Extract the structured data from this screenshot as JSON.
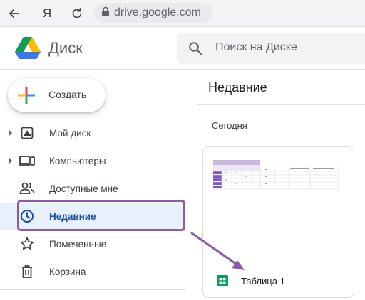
{
  "browser": {
    "url": "drive.google.com",
    "yandex_glyph": "Я"
  },
  "header": {
    "app_title": "Диск",
    "search_placeholder": "Поиск на Диске"
  },
  "sidebar": {
    "create_label": "Создать",
    "items": [
      {
        "label": "Мой диск",
        "icon": "my-drive-icon",
        "expandable": true
      },
      {
        "label": "Компьютеры",
        "icon": "computers-icon",
        "expandable": true
      },
      {
        "label": "Доступные мне",
        "icon": "shared-with-me-icon",
        "expandable": false
      },
      {
        "label": "Недавние",
        "icon": "recent-clock-icon",
        "expandable": false,
        "active": true
      },
      {
        "label": "Помеченные",
        "icon": "star-icon",
        "expandable": false
      },
      {
        "label": "Корзина",
        "icon": "trash-icon",
        "expandable": false
      }
    ]
  },
  "main": {
    "title": "Недавние",
    "section": "Сегодня",
    "files": [
      {
        "name": "Таблица 1",
        "type": "spreadsheet",
        "icon": "google-sheets-icon"
      }
    ]
  },
  "colors": {
    "active_bg": "#e8f0fe",
    "active_text": "#174ea6",
    "annotation": "#8e5aa8",
    "sheets_green": "#0f9d58"
  }
}
